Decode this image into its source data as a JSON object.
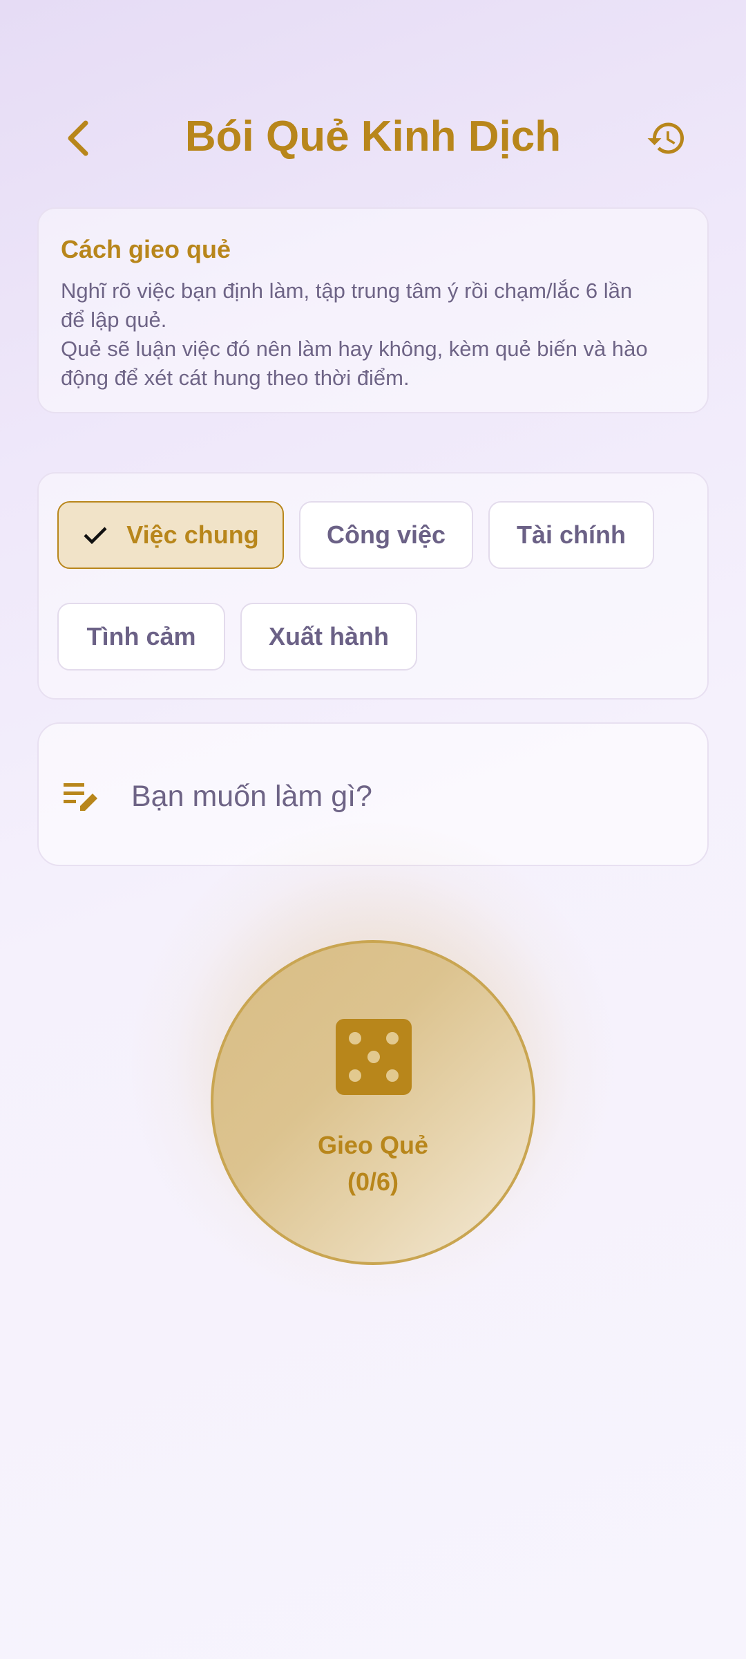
{
  "header": {
    "title": "Bói Quẻ Kinh Dịch",
    "back_icon": "chevron-left-icon",
    "history_icon": "history-icon"
  },
  "info": {
    "title": "Cách gieo quẻ",
    "line1": "Nghĩ rõ việc bạn định làm, tập trung tâm ý rồi chạm/lắc 6 lần",
    "line2": "để lập quẻ.",
    "line3": "Quẻ sẽ luận việc đó nên làm hay không, kèm quẻ biến và hào",
    "line4": "động để xét cát hung theo thời điểm."
  },
  "categories": {
    "selected": "Việc chung",
    "items": [
      {
        "label": "Việc chung"
      },
      {
        "label": "Công việc"
      },
      {
        "label": "Tài chính"
      },
      {
        "label": "Tình cảm"
      },
      {
        "label": "Xuất hành"
      }
    ]
  },
  "question": {
    "placeholder": "Bạn muốn làm gì?",
    "value": "",
    "icon": "edit-note-icon"
  },
  "cast": {
    "label": "Gieo Quẻ",
    "progress_text": "(0/6)",
    "progress_done": 0,
    "progress_total": 6,
    "icon": "dice-five-icon"
  },
  "colors": {
    "accent": "#b8861b",
    "text_muted": "#6e6486",
    "chip_selected_bg": "#f1e3c8"
  }
}
